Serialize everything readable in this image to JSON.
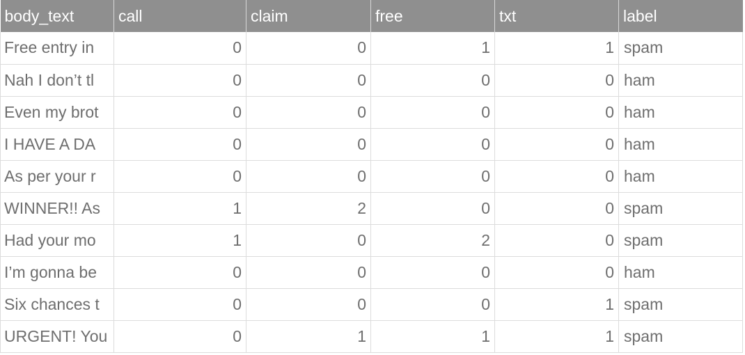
{
  "table": {
    "columns": [
      "body_text",
      "call",
      "claim",
      "free",
      "txt",
      "label"
    ],
    "rows": [
      [
        "Free entry in",
        "0",
        "0",
        "1",
        "1",
        "spam"
      ],
      [
        "Nah I don’t tl",
        "0",
        "0",
        "0",
        "0",
        "ham"
      ],
      [
        "Even my brot",
        "0",
        "0",
        "0",
        "0",
        "ham"
      ],
      [
        "I HAVE A DA",
        "0",
        "0",
        "0",
        "0",
        "ham"
      ],
      [
        "As per your r",
        "0",
        "0",
        "0",
        "0",
        "ham"
      ],
      [
        "WINNER!! As",
        "1",
        "2",
        "0",
        "0",
        "spam"
      ],
      [
        "Had your mo",
        "1",
        "0",
        "2",
        "0",
        "spam"
      ],
      [
        "I’m gonna be",
        "0",
        "0",
        "0",
        "0",
        "ham"
      ],
      [
        "Six chances t",
        "0",
        "0",
        "0",
        "1",
        "spam"
      ],
      [
        "URGENT! You",
        "0",
        "1",
        "1",
        "1",
        "spam"
      ]
    ]
  },
  "colors": {
    "header_background": "#8f8f8f",
    "header_text": "#ffffff",
    "cell_text": "#6e6e6e",
    "grid_line": "#dcdcdc"
  }
}
